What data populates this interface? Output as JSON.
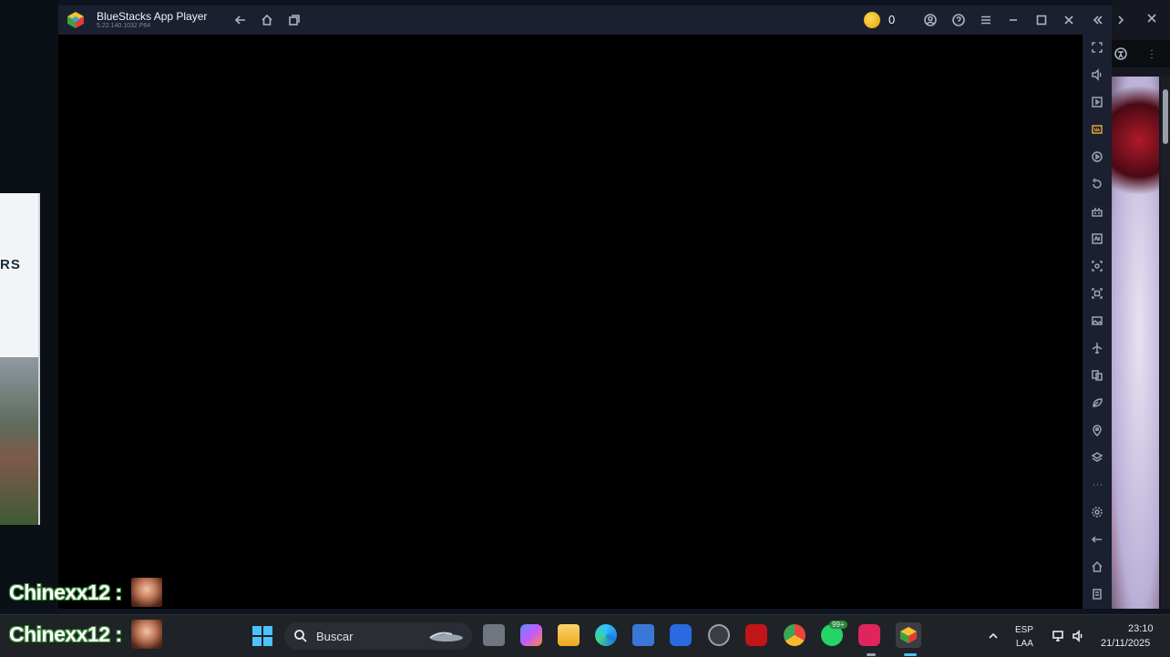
{
  "window": {
    "title": "BlueStacks App Player",
    "version": "5.22.140.1032 P64",
    "coins": "0"
  },
  "background_left": {
    "card_text": "RS"
  },
  "chat": [
    {
      "name": "Chinexx12 :"
    },
    {
      "name": "Chinexx12 :"
    }
  ],
  "taskbar": {
    "search_placeholder": "Buscar",
    "whatsapp_badge": "99+",
    "language": "ESP",
    "layout": "LAA",
    "time": "23:10",
    "date": "21/11/2025"
  },
  "colors": {
    "titlebar": "#1b2030",
    "sidebar": "#1b2030",
    "taskbar": "#1f2226",
    "coin": "#f2b50c"
  },
  "icons": {
    "titlebar": [
      "back-arrow-icon",
      "home-icon",
      "multi-instance-icon",
      "account-icon",
      "help-icon",
      "menu-icon",
      "minimize-icon",
      "maximize-icon",
      "close-icon",
      "collapse-sidebar-icon"
    ],
    "sidebar": [
      "fullscreen-icon",
      "volume-icon",
      "media-manager-icon",
      "macro-icon",
      "record-icon",
      "replay-icon",
      "game-controls-icon",
      "apk-install-icon",
      "screenshot-icon",
      "screen-record-icon",
      "gallery-icon",
      "airplane-icon",
      "multi-instance-icon",
      "eco-mode-icon",
      "location-icon",
      "layers-icon",
      "more-icon",
      "settings-icon",
      "back-icon",
      "home-icon",
      "recent-apps-icon"
    ]
  }
}
